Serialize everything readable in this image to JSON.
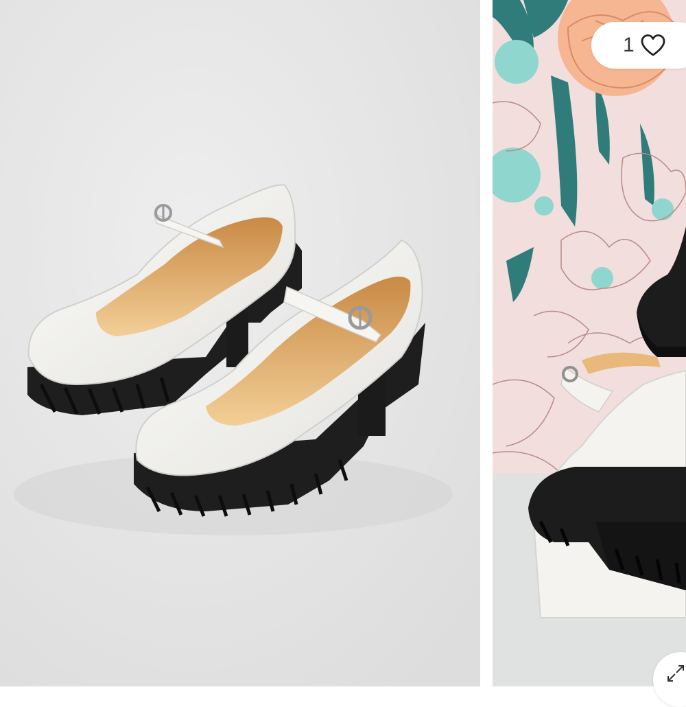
{
  "gallery": {
    "slides": [
      {
        "name": "product-image-pair-front"
      },
      {
        "name": "product-image-detail-heel"
      }
    ]
  },
  "like_button": {
    "count": "1",
    "icon": "heart-icon"
  },
  "expand_button": {
    "icon": "expand-icon"
  },
  "colors": {
    "background_main": "#e9eaea",
    "shoe_upper": "#f4f3ef",
    "shoe_sole": "#1e1e1e",
    "insole": "#e8b97a",
    "wallpaper_pink": "#f1dedd",
    "wallpaper_teal": "#2f7c7a",
    "wallpaper_peach": "#f6b692",
    "wallpaper_mint": "#8fd6cf"
  }
}
